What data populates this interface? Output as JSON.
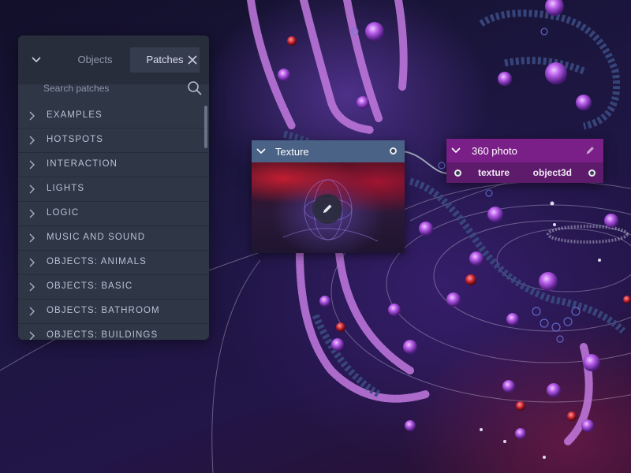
{
  "panel": {
    "tabs": [
      {
        "label": "Objects",
        "active": false
      },
      {
        "label": "Patches",
        "active": true
      }
    ],
    "search": {
      "placeholder": "Search patches",
      "value": ""
    },
    "categories": [
      "EXAMPLES",
      "HOTSPOTS",
      "INTERACTION",
      "LIGHTS",
      "LOGIC",
      "MUSIC AND SOUND",
      "OBJECTS: ANIMALS",
      "OBJECTS: BASIC",
      "OBJECTS: BATHROOM",
      "OBJECTS: BUILDINGS"
    ],
    "icons": {
      "collapse": "chevron-down-icon",
      "close": "close-icon",
      "search": "search-icon",
      "row": "chevron-right-icon"
    }
  },
  "nodes": {
    "texture": {
      "title": "Texture",
      "color": "#4a6286",
      "icons": {
        "collapse": "chevron-down-icon",
        "edit": "pencil-icon"
      }
    },
    "photo360": {
      "title": "360 photo",
      "color": "#7a1f87",
      "input_label": "texture",
      "output_label": "object3d",
      "icons": {
        "collapse": "chevron-down-icon",
        "edit": "pencil-icon"
      }
    }
  },
  "colors": {
    "panel_bg": "#2f3646",
    "panel_header": "#272d3b",
    "accent_purple": "#b060e8",
    "texture_header": "#4a6286",
    "photo_header": "#7a1f87"
  }
}
